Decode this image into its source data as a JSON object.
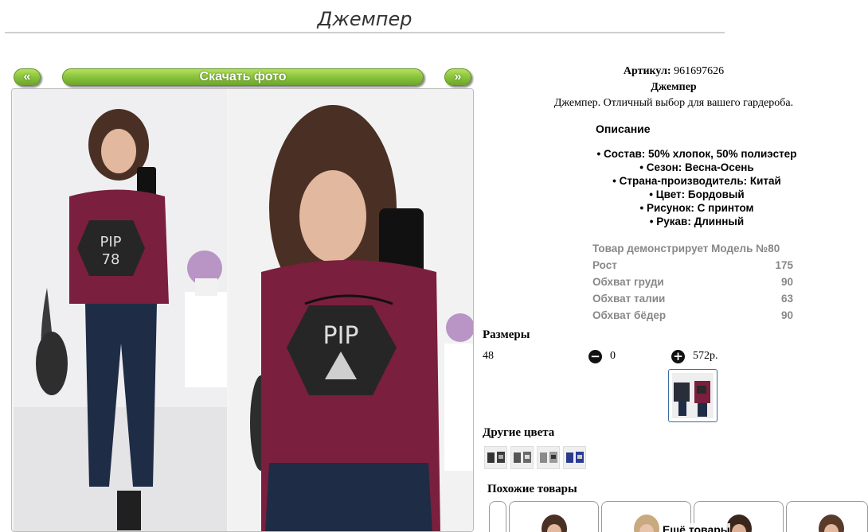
{
  "page": {
    "title": "Джемпер"
  },
  "gallery": {
    "prev_label": "«",
    "download_label": "Скачать фото",
    "next_label": "»"
  },
  "product": {
    "sku_label": "Артикул:",
    "sku_value": "961697626",
    "name": "Джемпер",
    "tagline": "Джемпер. Отличный выбор для вашего гардероба."
  },
  "description": {
    "heading": "Описание",
    "items": [
      "• Состав: 50% хлопок, 50% полиэстер",
      "• Сезон: Весна-Осень",
      "• Страна-производитель: Китай",
      "• Цвет: Бордовый",
      "• Рисунок: С принтом",
      "• Рукав: Длинный"
    ]
  },
  "model": {
    "rows": [
      {
        "label": "Товар демонстрирует Модель №80",
        "value": ""
      },
      {
        "label": "Рост",
        "value": "175"
      },
      {
        "label": "Обхват груди",
        "value": "90"
      },
      {
        "label": "Обхват талии",
        "value": "63"
      },
      {
        "label": "Обхват бёдер",
        "value": "90"
      }
    ]
  },
  "sizes": {
    "heading": "Размеры",
    "size": "48",
    "minus_icon": "minus-circle-icon",
    "quantity": "0",
    "plus_icon": "plus-circle-icon",
    "price": "572р."
  },
  "colors": {
    "heading": "Другие цвета"
  },
  "similar": {
    "heading": "Похожие товары",
    "more_label": "Ещё товары"
  },
  "palette": {
    "accent_green": "#8cc63f",
    "knit_burgundy": "#7a1f3d",
    "denim": "#1f2c45"
  }
}
